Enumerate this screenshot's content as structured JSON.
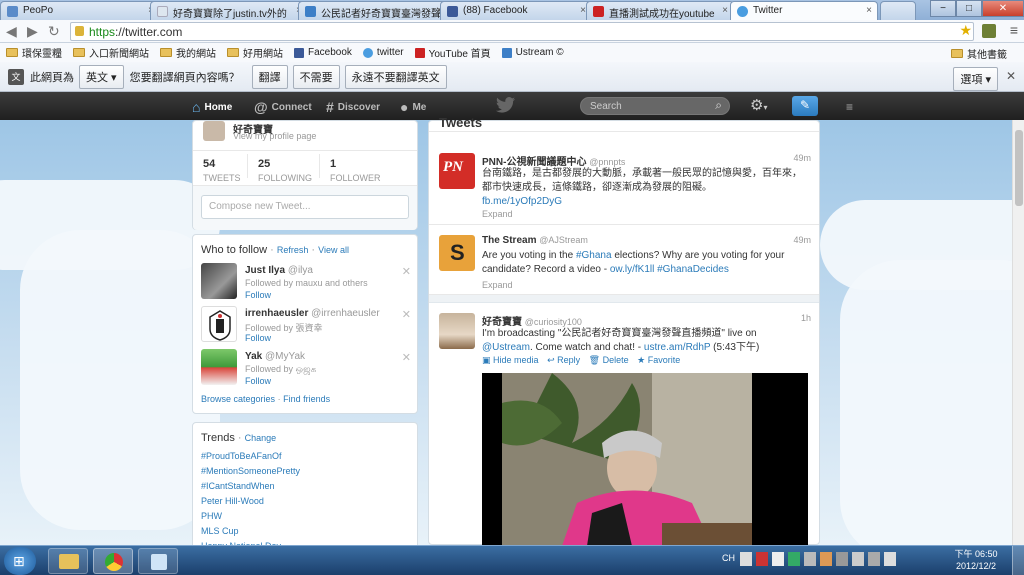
{
  "browser": {
    "tabs": [
      {
        "label": "PeoPo",
        "favicon_color": "#5a8bc9"
      },
      {
        "label": "好奇寶寶除了justin.tv外的",
        "favicon_color": "#dde6ef"
      },
      {
        "label": "公民記者好奇寶寶臺灣發聲",
        "favicon_color": "#3d7fc7"
      },
      {
        "label": "(88) Facebook",
        "favicon_color": "#3b5998"
      },
      {
        "label": "直播測試成功在youtube",
        "favicon_color": "#cc2222"
      },
      {
        "label": "Twitter",
        "favicon_color": "#4a9de0"
      }
    ],
    "window_buttons": {
      "minimize": "−",
      "maximize": "□",
      "close": "✕"
    },
    "url_scheme": "https",
    "url_rest": "://twitter.com",
    "bookmarks": [
      {
        "label": "環保靈糧",
        "icon": "folder-icon"
      },
      {
        "label": "入口新聞網站",
        "icon": "folder-icon"
      },
      {
        "label": "我的網站",
        "icon": "folder-icon"
      },
      {
        "label": "好用網站",
        "icon": "folder-icon"
      },
      {
        "label": "Facebook",
        "icon": "facebook-icon"
      },
      {
        "label": "twitter",
        "icon": "twitter-icon"
      },
      {
        "label": "YouTube 首頁",
        "icon": "youtube-icon"
      },
      {
        "label": "Ustream ©",
        "icon": "ustream-icon"
      }
    ],
    "other_bookmarks": "其他書籤",
    "translate": {
      "prefix": "此網頁為",
      "language": "英文",
      "question": "您要翻譯網頁內容嗎？",
      "translate_btn": "翻譯",
      "no_btn": "不需要",
      "never_btn": "永遠不要翻譯英文",
      "options": "選項"
    }
  },
  "twitter": {
    "nav": {
      "home": "Home",
      "connect": "Connect",
      "discover": "Discover",
      "me": "Me"
    },
    "search_placeholder": "Search",
    "profile": {
      "name": "好奇寶寶",
      "view_profile": "View my profile page",
      "stats": [
        {
          "num": "54",
          "label": "TWEETS"
        },
        {
          "num": "25",
          "label": "FOLLOWING"
        },
        {
          "num": "1",
          "label": "FOLLOWER"
        }
      ],
      "compose_placeholder": "Compose new Tweet..."
    },
    "who_to_follow": {
      "title": "Who to follow",
      "refresh": "Refresh",
      "view_all": "View all",
      "sep": "·",
      "users": [
        {
          "name": "Just Ilya",
          "handle": "@ilya",
          "by": "Followed by mauxu and others",
          "follow": "Follow"
        },
        {
          "name": "irrenhaeusler",
          "handle": "@irrenhaeusler",
          "by": "Followed by 張資幸",
          "follow": "Follow"
        },
        {
          "name": "Yak",
          "handle": "@MyYak",
          "by": "Followed by ஒஜக",
          "follow": "Follow"
        }
      ],
      "browse": "Browse categories",
      "find": "Find friends"
    },
    "trends": {
      "title": "Trends",
      "change": "Change",
      "sep": "·",
      "items": [
        "#ProudToBeAFanOf",
        "#MentionSomeonePretty",
        "#ICantStandWhen",
        "Peter Hill-Wood",
        "PHW",
        "MLS Cup",
        "Happy National Day"
      ]
    },
    "stream_title": "Tweets",
    "tweets": [
      {
        "name": "PNN-公視新聞議題中心",
        "handle": "@pnnpts",
        "time": "49m",
        "text": "台南鐵路，是古都發展的大動脈，承載著一般民眾的記憶與愛，百年來，都市快速成長，這條鐵路，卻逐漸成為發展的阻礙。",
        "link": "fb.me/1yOfp2DyG",
        "expand": "Expand"
      },
      {
        "name": "The Stream",
        "handle": "@AJStream",
        "time": "49m",
        "text_a": "Are you voting in the ",
        "tag1": "#Ghana",
        "text_b": " elections? Why are you voting for your candidate? Record a video - ",
        "link": "ow.ly/fK1ll",
        "tag2": "#GhanaDecides",
        "expand": "Expand"
      },
      {
        "name": "好奇寶寶",
        "handle": "@curiosity100",
        "time": "1h",
        "text_a": "I'm broadcasting \"公民記者好奇寶寶臺灣發聲直播頻道\" live on ",
        "mention": "@Ustream",
        "text_b": ". Come watch and chat! - ",
        "link": "ustre.am/RdhP",
        "text_c": " (5:43下午)",
        "actions": {
          "hide": "Hide media",
          "reply": "Reply",
          "delete": "Delete",
          "favorite": "Favorite"
        }
      }
    ]
  },
  "taskbar": {
    "lang": "CH",
    "time": "下午 06:50",
    "date": "2012/12/2"
  },
  "colors": {
    "twitter_link": "#2b7bb9",
    "twitter_bar": "#2a2a2a",
    "pnn_red": "#d32d27",
    "stream_orange": "#e8a23a"
  }
}
